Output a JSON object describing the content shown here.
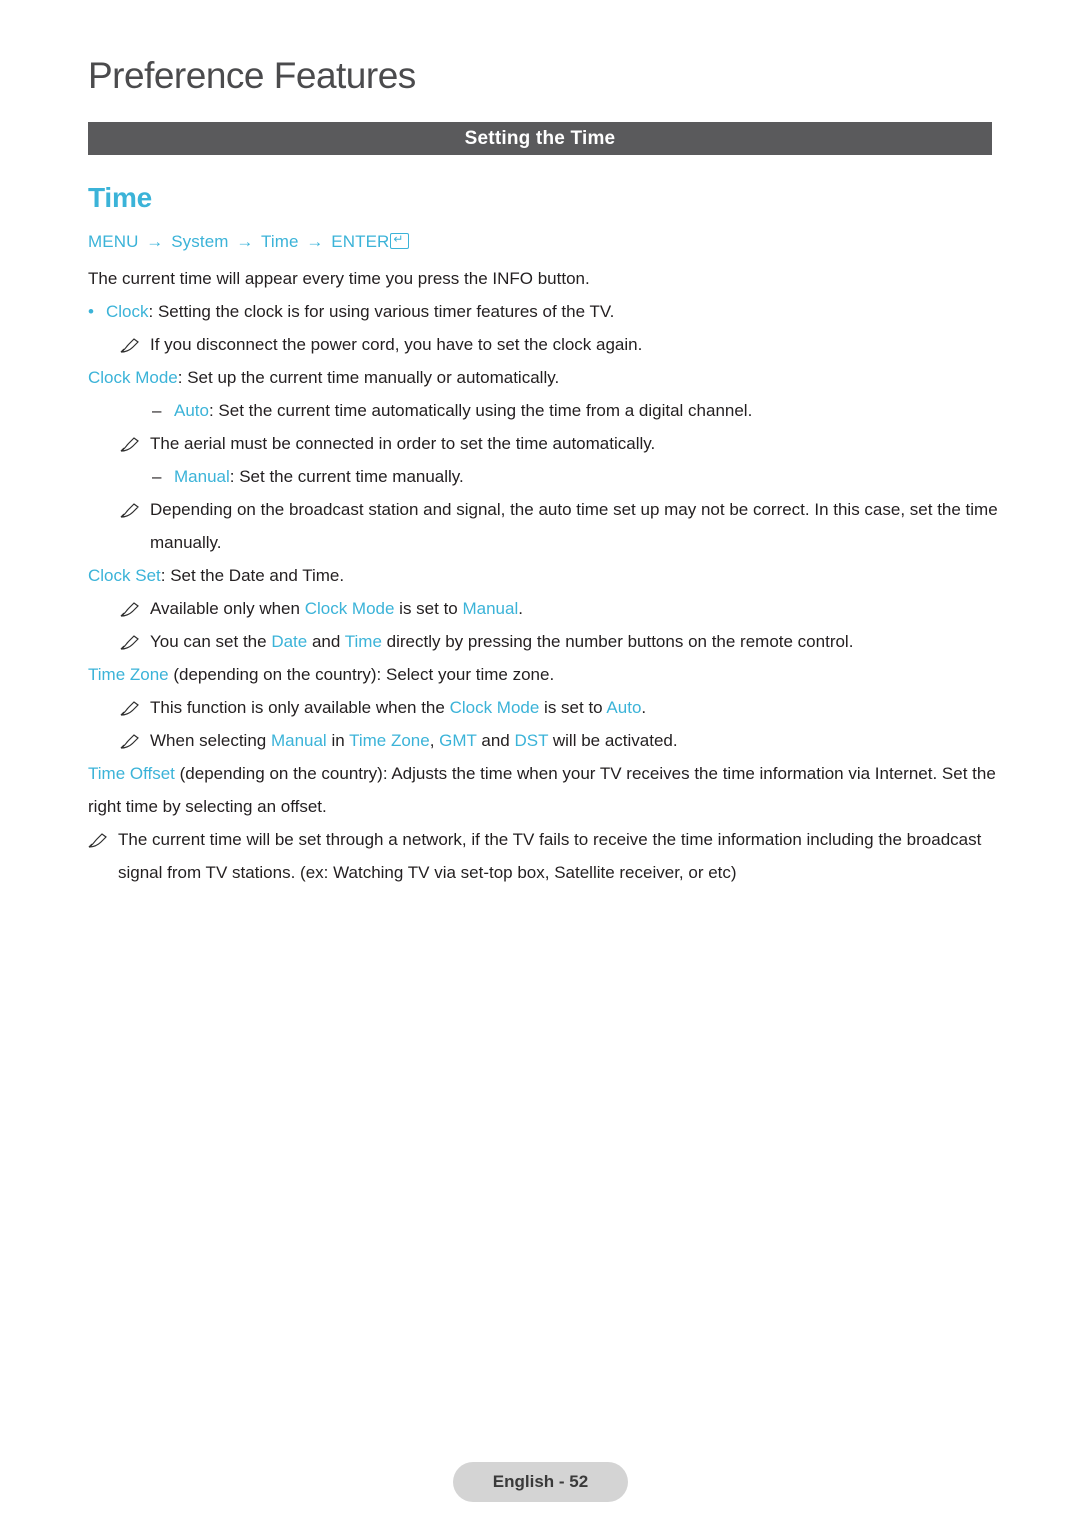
{
  "header": {
    "chapter_title": "Preference Features",
    "section_title": "Setting the Time"
  },
  "topic": {
    "heading": "Time",
    "menu_path": {
      "menu": "MENU",
      "arrow": "→",
      "system": "System",
      "time": "Time",
      "enter": "ENTER",
      "enter_icon": "enter-key-icon"
    }
  },
  "body": {
    "intro": "The current time will appear every time you press the INFO button.",
    "clock_label": "Clock",
    "clock_text": ": Setting the clock is for using various timer features of the TV.",
    "note_power_cord": "If you disconnect the power cord, you have to set the clock again.",
    "clock_mode_label": "Clock Mode",
    "clock_mode_text": ": Set up the current time manually or automatically.",
    "auto_label": "Auto",
    "auto_text": ": Set the current time automatically using the time from a digital channel.",
    "note_aerial": "The aerial must be connected in order to set the time automatically.",
    "manual_label": "Manual",
    "manual_text": ": Set the current time manually.",
    "note_depending": "Depending on the broadcast station and signal, the auto time set up may not be correct. In this case, set the time manually.",
    "clock_set_label": "Clock Set",
    "clock_set_text": ": Set the Date and Time.",
    "note_available_pre": "Available only when ",
    "note_available_mid": " is set to ",
    "note_available_end": ".",
    "note_available_clock_mode": "Clock Mode",
    "note_available_manual": "Manual",
    "note_numbers_pre": "You can set the ",
    "note_numbers_date": "Date",
    "note_numbers_and": " and ",
    "note_numbers_time": "Time",
    "note_numbers_end": " directly by pressing the number buttons on the remote control.",
    "time_zone_label": "Time Zone",
    "time_zone_text": " (depending on the country): Select your time zone.",
    "note_function_pre": "This function is only available when the ",
    "note_function_clock_mode": "Clock Mode",
    "note_function_mid": " is set to ",
    "note_function_auto": "Auto",
    "note_function_end": ".",
    "note_selecting_pre": "When selecting ",
    "note_selecting_manual": "Manual",
    "note_selecting_in": " in ",
    "note_selecting_time_zone": "Time Zone",
    "note_selecting_comma": ", ",
    "note_selecting_gmt": "GMT",
    "note_selecting_and": " and ",
    "note_selecting_dst": "DST",
    "note_selecting_end": " will be activated.",
    "time_offset_label": "Time Offset",
    "time_offset_text": " (depending on the country): Adjusts the time when your TV receives the time information via Internet. Set the right time by selecting an offset.",
    "note_network": "The current time will be set through a network, if the TV fails to receive the time information including the broadcast signal from TV stations. (ex: Watching TV via set-top box, Satellite receiver, or etc)"
  },
  "footer": {
    "page_label": "English - 52"
  },
  "colors": {
    "accent": "#3bb3d8",
    "section_bar": "#5a5a5c",
    "footer_bg": "#d4d4d4",
    "text": "#231f20"
  }
}
